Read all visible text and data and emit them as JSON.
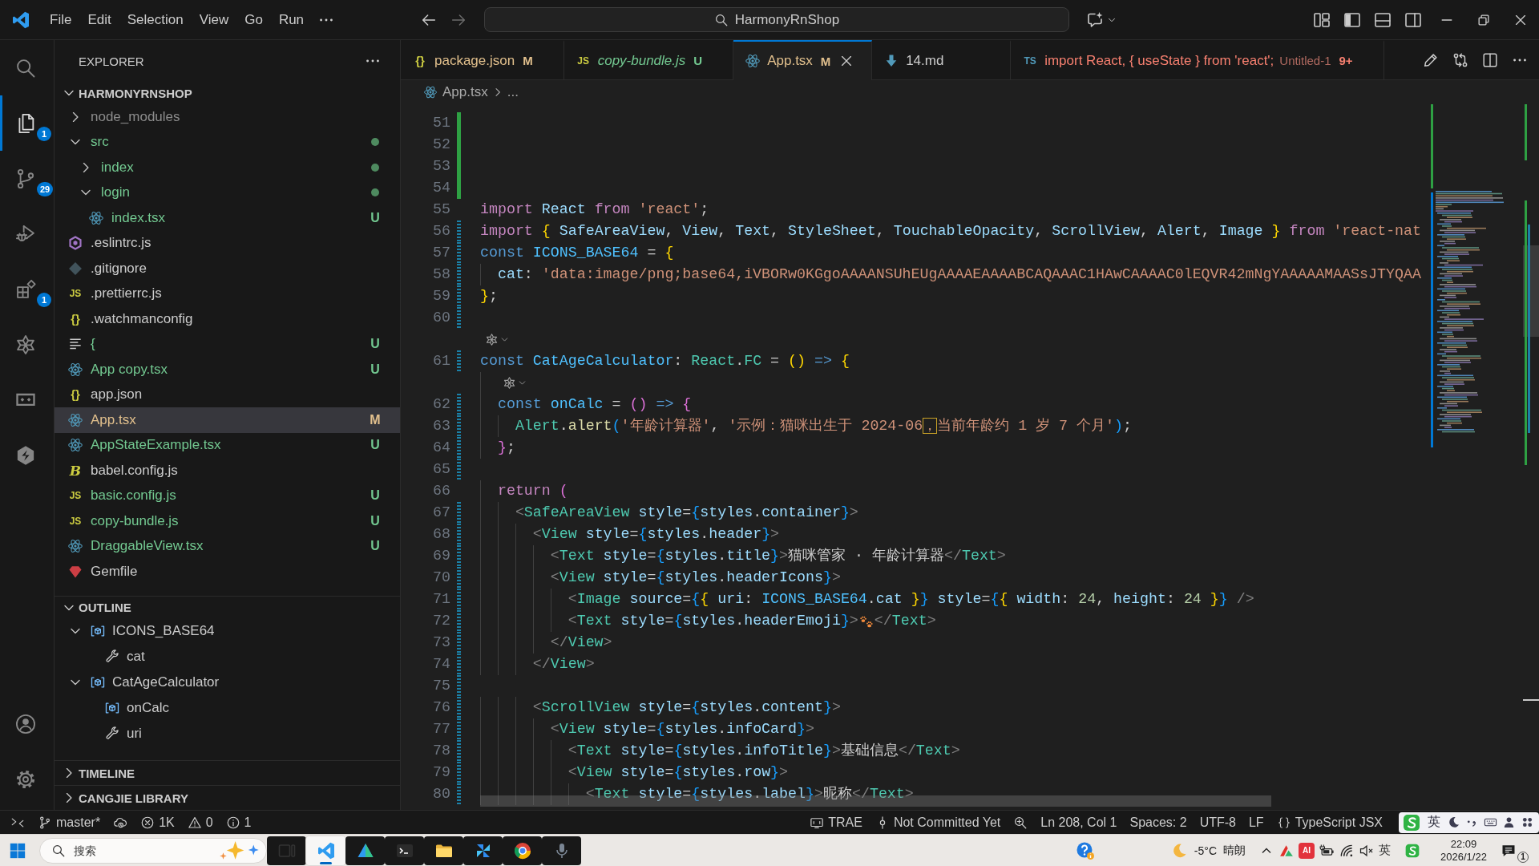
{
  "title_bar": {
    "menu": [
      "File",
      "Edit",
      "Selection",
      "View",
      "Go",
      "Run"
    ],
    "nav": [
      {
        "kind": "back",
        "disabled": false
      },
      {
        "kind": "forward",
        "disabled": true
      }
    ],
    "command_center": {
      "label": "HarmonyRnShop"
    },
    "layout_toggles": [
      {
        "kind": "layout",
        "on": false
      },
      {
        "kind": "sidebar-left",
        "on": true
      },
      {
        "kind": "panel",
        "on": false
      },
      {
        "kind": "sidebar-right",
        "on": false
      }
    ]
  },
  "activity_bar": {
    "items": [
      {
        "kind": "search",
        "selected": false
      },
      {
        "kind": "explorer",
        "selected": true,
        "badge": "1"
      },
      {
        "kind": "source-control",
        "selected": false,
        "badge": "29"
      },
      {
        "kind": "run-debug",
        "selected": false
      },
      {
        "kind": "extensions",
        "selected": false,
        "badge": "1"
      },
      {
        "kind": "star-knot",
        "selected": false
      },
      {
        "kind": "remote",
        "selected": false
      },
      {
        "kind": "hex-logo",
        "selected": false
      }
    ],
    "bottom": [
      {
        "kind": "account"
      },
      {
        "kind": "settings"
      }
    ]
  },
  "sidebar": {
    "title": "EXPLORER",
    "root": {
      "label": "HARMONYRNSHOP",
      "expanded": true
    },
    "tree": [
      {
        "kind": "folder",
        "label": "node_modules",
        "color": "#8c8c8c",
        "expanded": false,
        "dot": false,
        "selected": false
      },
      {
        "kind": "folder",
        "label": "src",
        "color": "#73c991",
        "expanded": true,
        "dot": true,
        "selected": false,
        "children": [
          {
            "kind": "folder",
            "label": "index",
            "color": "#73c991",
            "expanded": false,
            "dot": true,
            "selected": false
          },
          {
            "kind": "folder",
            "label": "login",
            "color": "#73c991",
            "expanded": true,
            "dot": true,
            "selected": false,
            "children": [
              {
                "kind": "react",
                "label": "index.tsx",
                "color": "#73c991",
                "decoration": "U",
                "selected": false
              }
            ]
          }
        ]
      },
      {
        "kind": "eslint",
        "label": ".eslintrc.js",
        "color": "#cccccc",
        "selected": false
      },
      {
        "kind": "git",
        "label": ".gitignore",
        "color": "#cccccc",
        "selected": false
      },
      {
        "kind": "js",
        "label": ".prettierrc.js",
        "icon_text": "JS",
        "color": "#cccccc",
        "selected": false
      },
      {
        "kind": "json",
        "label": ".watchmanconfig",
        "icon_text": "{}",
        "color": "#cccccc",
        "selected": false
      },
      {
        "kind": "lines",
        "label": "{",
        "color": "#73c991",
        "decoration": "U",
        "selected": false
      },
      {
        "kind": "react",
        "label": "App copy.tsx",
        "color": "#73c991",
        "decoration": "U",
        "selected": false
      },
      {
        "kind": "json",
        "label": "app.json",
        "icon_text": "{}",
        "color": "#cccccc",
        "selected": false
      },
      {
        "kind": "react",
        "label": "App.tsx",
        "color": "#e2c08d",
        "decoration": "M",
        "selected": true
      },
      {
        "kind": "react",
        "label": "AppStateExample.tsx",
        "color": "#73c991",
        "decoration": "U",
        "selected": false
      },
      {
        "kind": "babel",
        "label": "babel.config.js",
        "icon_text": "B",
        "color": "#cccccc",
        "selected": false
      },
      {
        "kind": "js",
        "label": "basic.config.js",
        "icon_text": "JS",
        "color": "#73c991",
        "decoration": "U",
        "selected": false
      },
      {
        "kind": "js",
        "label": "copy-bundle.js",
        "icon_text": "JS",
        "color": "#73c991",
        "decoration": "U",
        "selected": false
      },
      {
        "kind": "react",
        "label": "DraggableView.tsx",
        "color": "#73c991",
        "decoration": "U",
        "selected": false
      },
      {
        "kind": "gem",
        "label": "Gemfile",
        "color": "#cccccc",
        "selected": false
      }
    ],
    "outline": {
      "label": "OUTLINE",
      "expanded": true,
      "items": [
        {
          "kind": "variable",
          "label": "ICONS_BASE64",
          "expanded": true,
          "selected": false,
          "children": [
            {
              "kind": "property",
              "label": "cat",
              "selected": false
            }
          ]
        },
        {
          "kind": "variable",
          "label": "CatAgeCalculator",
          "expanded": true,
          "selected": false,
          "children": [
            {
              "kind": "variable",
              "label": "onCalc",
              "selected": false
            },
            {
              "kind": "property",
              "label": "uri",
              "selected": false
            }
          ]
        }
      ]
    },
    "sections": [
      {
        "label": "TIMELINE",
        "expanded": false
      },
      {
        "label": "CANGJIE LIBRARY",
        "expanded": false
      }
    ]
  },
  "editor": {
    "tabs": [
      {
        "kind": "json",
        "label": "package.json",
        "icon_text": "{}",
        "color": "#e2c08d",
        "decoration": "M",
        "selected": false,
        "preview": false
      },
      {
        "kind": "js",
        "label": "copy-bundle.js",
        "icon_text": "JS",
        "color": "#73c991",
        "decoration": "U",
        "selected": false,
        "preview": true
      },
      {
        "kind": "react",
        "label": "App.tsx",
        "color": "#e2c08d",
        "decoration": "M",
        "selected": true,
        "preview": false
      },
      {
        "kind": "markdown",
        "label": "14.md",
        "color": "#cccccc",
        "selected": false,
        "preview": false
      },
      {
        "kind": "ts",
        "label": "import React, { useState } from 'react';",
        "icon_text": "TS",
        "color": "#f88070",
        "description": "Untitled-1",
        "problems": "9+",
        "selected": false,
        "preview": false
      }
    ],
    "breadcrumb": [
      {
        "kind": "react",
        "label": "App.tsx"
      },
      {
        "label": "..."
      }
    ],
    "lines": [
      {
        "kind": "code",
        "number": "51",
        "added": true,
        "modified": false
      },
      {
        "kind": "code",
        "number": "52",
        "added": true,
        "modified": false
      },
      {
        "kind": "code",
        "number": "53",
        "added": true,
        "modified": false
      },
      {
        "kind": "code",
        "number": "54",
        "added": true,
        "modified": false
      },
      {
        "kind": "code",
        "number": "55",
        "added": false,
        "modified": false,
        "tokens": [
          {
            "kind": "ctl",
            "text": "import "
          },
          {
            "kind": "var",
            "text": "React "
          },
          {
            "kind": "ctl",
            "text": "from "
          },
          {
            "kind": "str",
            "text": "'react'"
          },
          {
            "kind": "p",
            "text": ";"
          }
        ]
      },
      {
        "kind": "code",
        "number": "56",
        "added": false,
        "modified": true,
        "tokens": [
          {
            "kind": "ctl",
            "text": "import "
          },
          {
            "kind": "b1",
            "text": "{ "
          },
          {
            "kind": "var",
            "text": "SafeAreaView"
          },
          {
            "kind": "p",
            "text": ", "
          },
          {
            "kind": "var",
            "text": "View"
          },
          {
            "kind": "p",
            "text": ", "
          },
          {
            "kind": "var",
            "text": "Text"
          },
          {
            "kind": "p",
            "text": ", "
          },
          {
            "kind": "var",
            "text": "StyleSheet"
          },
          {
            "kind": "p",
            "text": ", "
          },
          {
            "kind": "var",
            "text": "TouchableOpacity"
          },
          {
            "kind": "p",
            "text": ", "
          },
          {
            "kind": "var",
            "text": "ScrollView"
          },
          {
            "kind": "p",
            "text": ", "
          },
          {
            "kind": "var",
            "text": "Alert"
          },
          {
            "kind": "p",
            "text": ", "
          },
          {
            "kind": "var",
            "text": "Image "
          },
          {
            "kind": "b1",
            "text": "} "
          },
          {
            "kind": "ctl",
            "text": "from "
          },
          {
            "kind": "str",
            "text": "'react-nat"
          }
        ]
      },
      {
        "kind": "code",
        "number": "57",
        "added": false,
        "modified": true,
        "tokens": [
          {
            "kind": "kw",
            "text": "const "
          },
          {
            "kind": "const",
            "text": "ICONS_BASE64 "
          },
          {
            "kind": "p",
            "text": "= "
          },
          {
            "kind": "b1",
            "text": "{"
          }
        ]
      },
      {
        "kind": "code",
        "number": "58",
        "added": false,
        "modified": true,
        "tokens": [
          {
            "kind": "var",
            "text": "  cat"
          },
          {
            "kind": "p",
            "text": ": "
          },
          {
            "kind": "str",
            "text": "'data:image/png;base64,iVBORw0KGgoAAAANSUhEUgAAAAEAAAABCAQAAAC1HAwCAAAAC0lEQVR42mNgYAAAAAMAASsJTYQAA"
          }
        ]
      },
      {
        "kind": "code",
        "number": "59",
        "added": false,
        "modified": true,
        "tokens": [
          {
            "kind": "b1",
            "text": "}"
          },
          {
            "kind": "p",
            "text": ";"
          }
        ]
      },
      {
        "kind": "code",
        "number": "60",
        "added": false,
        "modified": true
      },
      {
        "kind": "codelens",
        "added": false,
        "modified": false
      },
      {
        "kind": "code",
        "number": "61",
        "added": false,
        "modified": true,
        "tokens": [
          {
            "kind": "kw",
            "text": "const "
          },
          {
            "kind": "const",
            "text": "CatAgeCalculator"
          },
          {
            "kind": "p",
            "text": ": "
          },
          {
            "kind": "type",
            "text": "React"
          },
          {
            "kind": "p",
            "text": "."
          },
          {
            "kind": "type",
            "text": "FC "
          },
          {
            "kind": "p",
            "text": "= "
          },
          {
            "kind": "b1",
            "text": "() "
          },
          {
            "kind": "kw",
            "text": "=> "
          },
          {
            "kind": "b1",
            "text": "{"
          }
        ]
      },
      {
        "kind": "codelens",
        "added": false,
        "modified": false
      },
      {
        "kind": "code",
        "number": "62",
        "added": false,
        "modified": true,
        "tokens": [
          {
            "kind": "kw",
            "text": "  const "
          },
          {
            "kind": "const",
            "text": "onCalc "
          },
          {
            "kind": "p",
            "text": "= "
          },
          {
            "kind": "b2",
            "text": "() "
          },
          {
            "kind": "kw",
            "text": "=> "
          },
          {
            "kind": "b2",
            "text": "{"
          }
        ]
      },
      {
        "kind": "code",
        "number": "63",
        "added": false,
        "modified": true,
        "tokens": [
          {
            "kind": "type",
            "text": "    Alert"
          },
          {
            "kind": "p",
            "text": "."
          },
          {
            "kind": "fn",
            "text": "alert"
          },
          {
            "kind": "b3",
            "text": "("
          },
          {
            "kind": "str",
            "text": "'年龄计算器'"
          },
          {
            "kind": "p",
            "text": ", "
          },
          {
            "kind": "str",
            "text": "'示例：猫咪出生于 2024-06"
          },
          {
            "kind": "boxstr",
            "text": "，"
          },
          {
            "kind": "str",
            "text": "当前年龄约 1 岁 7 个月'"
          },
          {
            "kind": "b3",
            "text": ")"
          },
          {
            "kind": "p",
            "text": ";"
          }
        ]
      },
      {
        "kind": "code",
        "number": "64",
        "added": false,
        "modified": true,
        "tokens": [
          {
            "kind": "b2",
            "text": "  }"
          },
          {
            "kind": "p",
            "text": ";"
          }
        ]
      },
      {
        "kind": "code",
        "number": "65",
        "added": false,
        "modified": true
      },
      {
        "kind": "code",
        "number": "66",
        "added": false,
        "modified": false,
        "tokens": [
          {
            "kind": "ctl",
            "text": "  return "
          },
          {
            "kind": "b2",
            "text": "("
          }
        ]
      },
      {
        "kind": "code",
        "number": "67",
        "added": false,
        "modified": true,
        "tokens": [
          {
            "kind": "tp",
            "text": "    <"
          },
          {
            "kind": "tag",
            "text": "SafeAreaView "
          },
          {
            "kind": "attr",
            "text": "style"
          },
          {
            "kind": "p",
            "text": "="
          },
          {
            "kind": "b3",
            "text": "{"
          },
          {
            "kind": "var",
            "text": "styles"
          },
          {
            "kind": "p",
            "text": "."
          },
          {
            "kind": "var",
            "text": "container"
          },
          {
            "kind": "b3",
            "text": "}"
          },
          {
            "kind": "tp",
            "text": ">"
          }
        ]
      },
      {
        "kind": "code",
        "number": "68",
        "added": false,
        "modified": true,
        "tokens": [
          {
            "kind": "tp",
            "text": "      <"
          },
          {
            "kind": "tag",
            "text": "View "
          },
          {
            "kind": "attr",
            "text": "style"
          },
          {
            "kind": "p",
            "text": "="
          },
          {
            "kind": "b3",
            "text": "{"
          },
          {
            "kind": "var",
            "text": "styles"
          },
          {
            "kind": "p",
            "text": "."
          },
          {
            "kind": "var",
            "text": "header"
          },
          {
            "kind": "b3",
            "text": "}"
          },
          {
            "kind": "tp",
            "text": ">"
          }
        ]
      },
      {
        "kind": "code",
        "number": "69",
        "added": false,
        "modified": true,
        "tokens": [
          {
            "kind": "tp",
            "text": "        <"
          },
          {
            "kind": "tag",
            "text": "Text "
          },
          {
            "kind": "attr",
            "text": "style"
          },
          {
            "kind": "p",
            "text": "="
          },
          {
            "kind": "b3",
            "text": "{"
          },
          {
            "kind": "var",
            "text": "styles"
          },
          {
            "kind": "p",
            "text": "."
          },
          {
            "kind": "var",
            "text": "title"
          },
          {
            "kind": "b3",
            "text": "}"
          },
          {
            "kind": "tp",
            "text": ">"
          },
          {
            "kind": "txt",
            "text": "猫咪管家 · 年龄计算器"
          },
          {
            "kind": "tp",
            "text": "</"
          },
          {
            "kind": "tag",
            "text": "Text"
          },
          {
            "kind": "tp",
            "text": ">"
          }
        ]
      },
      {
        "kind": "code",
        "number": "70",
        "added": false,
        "modified": true,
        "tokens": [
          {
            "kind": "tp",
            "text": "        <"
          },
          {
            "kind": "tag",
            "text": "View "
          },
          {
            "kind": "attr",
            "text": "style"
          },
          {
            "kind": "p",
            "text": "="
          },
          {
            "kind": "b3",
            "text": "{"
          },
          {
            "kind": "var",
            "text": "styles"
          },
          {
            "kind": "p",
            "text": "."
          },
          {
            "kind": "var",
            "text": "headerIcons"
          },
          {
            "kind": "b3",
            "text": "}"
          },
          {
            "kind": "tp",
            "text": ">"
          }
        ]
      },
      {
        "kind": "code",
        "number": "71",
        "added": false,
        "modified": true,
        "tokens": [
          {
            "kind": "tp",
            "text": "          <"
          },
          {
            "kind": "tag",
            "text": "Image "
          },
          {
            "kind": "attr",
            "text": "source"
          },
          {
            "kind": "p",
            "text": "="
          },
          {
            "kind": "b3",
            "text": "{"
          },
          {
            "kind": "b1",
            "text": "{ "
          },
          {
            "kind": "var",
            "text": "uri"
          },
          {
            "kind": "p",
            "text": ": "
          },
          {
            "kind": "const",
            "text": "ICONS_BASE64"
          },
          {
            "kind": "p",
            "text": "."
          },
          {
            "kind": "var",
            "text": "cat "
          },
          {
            "kind": "b1",
            "text": "}"
          },
          {
            "kind": "b3",
            "text": "} "
          },
          {
            "kind": "attr",
            "text": "style"
          },
          {
            "kind": "p",
            "text": "="
          },
          {
            "kind": "b3",
            "text": "{"
          },
          {
            "kind": "b1",
            "text": "{ "
          },
          {
            "kind": "var",
            "text": "width"
          },
          {
            "kind": "p",
            "text": ": "
          },
          {
            "kind": "num",
            "text": "24"
          },
          {
            "kind": "p",
            "text": ", "
          },
          {
            "kind": "var",
            "text": "height"
          },
          {
            "kind": "p",
            "text": ": "
          },
          {
            "kind": "num",
            "text": "24 "
          },
          {
            "kind": "b1",
            "text": "}"
          },
          {
            "kind": "b3",
            "text": "} "
          },
          {
            "kind": "tp",
            "text": "/>"
          }
        ]
      },
      {
        "kind": "code",
        "number": "72",
        "added": false,
        "modified": true,
        "tokens": [
          {
            "kind": "tp",
            "text": "          <"
          },
          {
            "kind": "tag",
            "text": "Text "
          },
          {
            "kind": "attr",
            "text": "style"
          },
          {
            "kind": "p",
            "text": "="
          },
          {
            "kind": "b3",
            "text": "{"
          },
          {
            "kind": "var",
            "text": "styles"
          },
          {
            "kind": "p",
            "text": "."
          },
          {
            "kind": "var",
            "text": "headerEmoji"
          },
          {
            "kind": "b3",
            "text": "}"
          },
          {
            "kind": "tp",
            "text": ">"
          },
          {
            "kind": "paw"
          },
          {
            "kind": "tp",
            "text": "</"
          },
          {
            "kind": "tag",
            "text": "Text"
          },
          {
            "kind": "tp",
            "text": ">"
          }
        ]
      },
      {
        "kind": "code",
        "number": "73",
        "added": false,
        "modified": true,
        "tokens": [
          {
            "kind": "tp",
            "text": "        </"
          },
          {
            "kind": "tag",
            "text": "View"
          },
          {
            "kind": "tp",
            "text": ">"
          }
        ]
      },
      {
        "kind": "code",
        "number": "74",
        "added": false,
        "modified": true,
        "tokens": [
          {
            "kind": "tp",
            "text": "      </"
          },
          {
            "kind": "tag",
            "text": "View"
          },
          {
            "kind": "tp",
            "text": ">"
          }
        ]
      },
      {
        "kind": "code",
        "number": "75",
        "added": false,
        "modified": true
      },
      {
        "kind": "code",
        "number": "76",
        "added": false,
        "modified": true,
        "tokens": [
          {
            "kind": "tp",
            "text": "      <"
          },
          {
            "kind": "tag",
            "text": "ScrollView "
          },
          {
            "kind": "attr",
            "text": "style"
          },
          {
            "kind": "p",
            "text": "="
          },
          {
            "kind": "b3",
            "text": "{"
          },
          {
            "kind": "var",
            "text": "styles"
          },
          {
            "kind": "p",
            "text": "."
          },
          {
            "kind": "var",
            "text": "content"
          },
          {
            "kind": "b3",
            "text": "}"
          },
          {
            "kind": "tp",
            "text": ">"
          }
        ]
      },
      {
        "kind": "code",
        "number": "77",
        "added": false,
        "modified": true,
        "tokens": [
          {
            "kind": "tp",
            "text": "        <"
          },
          {
            "kind": "tag",
            "text": "View "
          },
          {
            "kind": "attr",
            "text": "style"
          },
          {
            "kind": "p",
            "text": "="
          },
          {
            "kind": "b3",
            "text": "{"
          },
          {
            "kind": "var",
            "text": "styles"
          },
          {
            "kind": "p",
            "text": "."
          },
          {
            "kind": "var",
            "text": "infoCard"
          },
          {
            "kind": "b3",
            "text": "}"
          },
          {
            "kind": "tp",
            "text": ">"
          }
        ]
      },
      {
        "kind": "code",
        "number": "78",
        "added": false,
        "modified": true,
        "tokens": [
          {
            "kind": "tp",
            "text": "          <"
          },
          {
            "kind": "tag",
            "text": "Text "
          },
          {
            "kind": "attr",
            "text": "style"
          },
          {
            "kind": "p",
            "text": "="
          },
          {
            "kind": "b3",
            "text": "{"
          },
          {
            "kind": "var",
            "text": "styles"
          },
          {
            "kind": "p",
            "text": "."
          },
          {
            "kind": "var",
            "text": "infoTitle"
          },
          {
            "kind": "b3",
            "text": "}"
          },
          {
            "kind": "tp",
            "text": ">"
          },
          {
            "kind": "txt",
            "text": "基础信息"
          },
          {
            "kind": "tp",
            "text": "</"
          },
          {
            "kind": "tag",
            "text": "Text"
          },
          {
            "kind": "tp",
            "text": ">"
          }
        ]
      },
      {
        "kind": "code",
        "number": "79",
        "added": false,
        "modified": true,
        "tokens": [
          {
            "kind": "tp",
            "text": "          <"
          },
          {
            "kind": "tag",
            "text": "View "
          },
          {
            "kind": "attr",
            "text": "style"
          },
          {
            "kind": "p",
            "text": "="
          },
          {
            "kind": "b3",
            "text": "{"
          },
          {
            "kind": "var",
            "text": "styles"
          },
          {
            "kind": "p",
            "text": "."
          },
          {
            "kind": "var",
            "text": "row"
          },
          {
            "kind": "b3",
            "text": "}"
          },
          {
            "kind": "tp",
            "text": ">"
          }
        ]
      },
      {
        "kind": "code",
        "number": "80",
        "added": false,
        "modified": true,
        "tokens": [
          {
            "kind": "tp",
            "text": "            <"
          },
          {
            "kind": "tag",
            "text": "Text "
          },
          {
            "kind": "attr",
            "text": "style"
          },
          {
            "kind": "p",
            "text": "="
          },
          {
            "kind": "b3",
            "text": "{"
          },
          {
            "kind": "var",
            "text": "styles"
          },
          {
            "kind": "p",
            "text": "."
          },
          {
            "kind": "var",
            "text": "label"
          },
          {
            "kind": "b3",
            "text": "}"
          },
          {
            "kind": "tp",
            "text": ">"
          },
          {
            "kind": "txt",
            "text": "昵称"
          },
          {
            "kind": "tp",
            "text": "</"
          },
          {
            "kind": "tag",
            "text": "Text"
          },
          {
            "kind": "tp",
            "text": ">"
          }
        ]
      }
    ]
  },
  "status_bar": {
    "left": [
      {
        "kind": "remote"
      },
      {
        "kind": "branch",
        "text": "master*"
      },
      {
        "kind": "sync"
      },
      {
        "kind": "errors",
        "text": "1K"
      },
      {
        "kind": "warnings",
        "text": "0"
      },
      {
        "kind": "info",
        "text": "1"
      }
    ],
    "right": [
      {
        "kind": "trae",
        "text": "TRAE"
      },
      {
        "kind": "commit",
        "text": "Not Committed Yet"
      },
      {
        "kind": "zoom"
      },
      {
        "kind": "position",
        "text": "Ln 208, Col 1"
      },
      {
        "kind": "indent",
        "text": "Spaces: 2"
      },
      {
        "kind": "encoding",
        "text": "UTF-8"
      },
      {
        "kind": "eol",
        "text": "LF"
      },
      {
        "kind": "language",
        "text": "TypeScript JSX"
      }
    ],
    "ime": [
      {
        "kind": "logo"
      },
      {
        "kind": "mode",
        "text": "英"
      },
      {
        "kind": "moon"
      },
      {
        "kind": "punct"
      },
      {
        "kind": "keyboard"
      },
      {
        "kind": "person"
      },
      {
        "kind": "dots"
      }
    ]
  },
  "taskbar": {
    "search": {
      "placeholder": "搜索"
    },
    "apps": [
      {
        "kind": "task-view",
        "selected": false
      },
      {
        "kind": "ribbon",
        "selected": true
      },
      {
        "kind": "triangle",
        "selected": false
      },
      {
        "kind": "terminal",
        "selected": false
      },
      {
        "kind": "folder",
        "selected": false
      },
      {
        "kind": "pinwheel",
        "selected": false
      },
      {
        "kind": "circle",
        "selected": false
      },
      {
        "kind": "microphone",
        "selected": false
      }
    ],
    "weather": {
      "temperature": "-5°C",
      "condition": "晴朗"
    },
    "tray": [
      {
        "kind": "chevron"
      },
      {
        "kind": "peak"
      },
      {
        "kind": "ai",
        "text": "AI"
      },
      {
        "kind": "battery"
      },
      {
        "kind": "wifi"
      },
      {
        "kind": "speaker"
      },
      {
        "kind": "ime",
        "text": "英"
      },
      {
        "kind": "s-logo"
      }
    ],
    "clock": {
      "time": "22:09",
      "date": "2026/1/22"
    },
    "notifications": {
      "count": "1"
    }
  }
}
